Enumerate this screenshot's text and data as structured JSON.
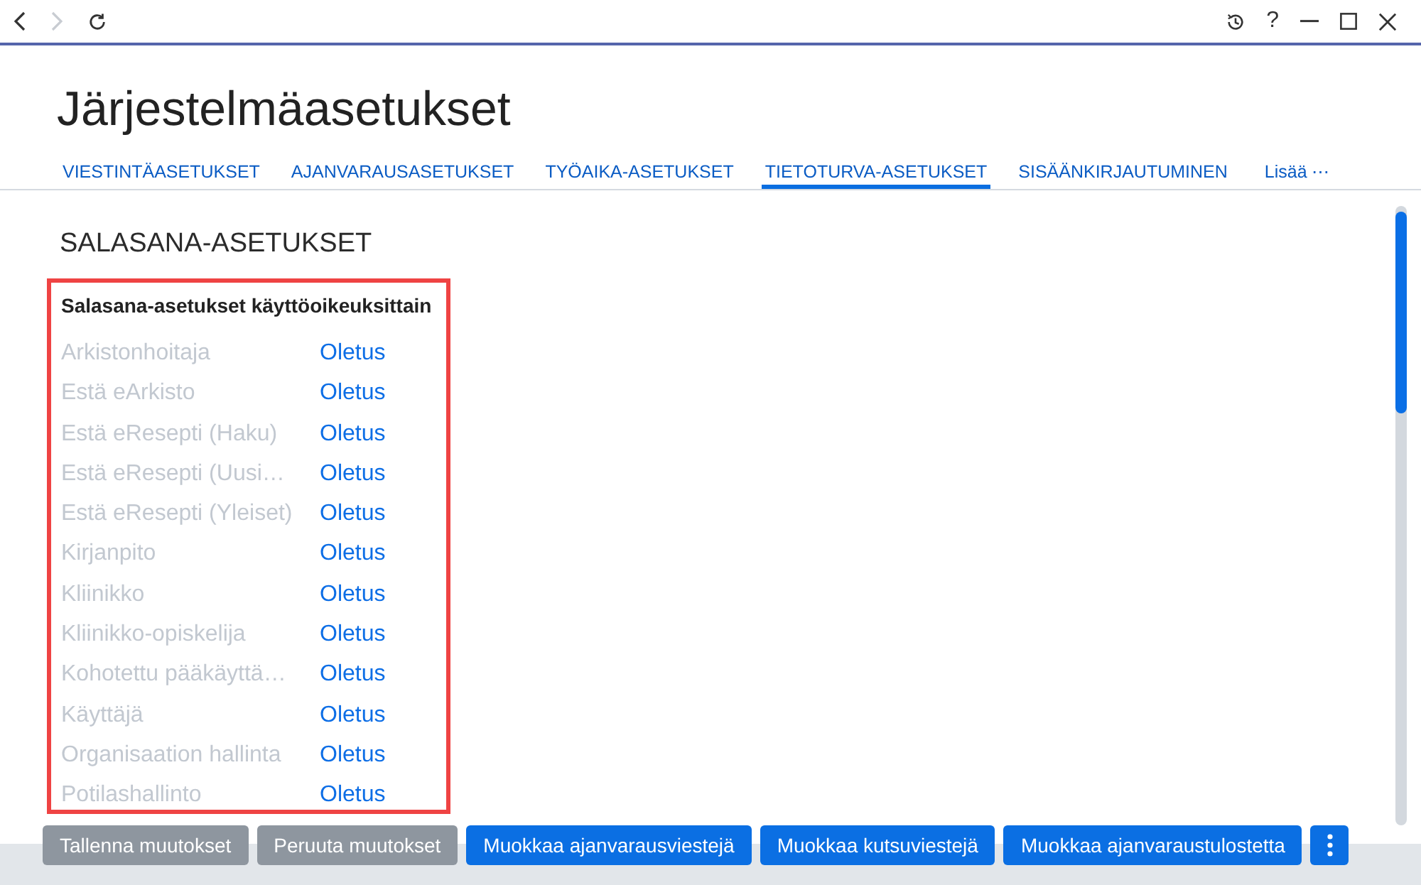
{
  "toolbar": {
    "back": {
      "disabled": false
    },
    "forward": {
      "disabled": true
    },
    "help": "?"
  },
  "page": {
    "title": "Järjestelmäasetukset"
  },
  "tabs": [
    {
      "label": "VIESTINTÄASETUKSET",
      "selected": false
    },
    {
      "label": "AJANVARAUSASETUKSET",
      "selected": false
    },
    {
      "label": "TYÖAIKA-ASETUKSET",
      "selected": false
    },
    {
      "label": "TIETOTURVA-ASETUKSET",
      "selected": true
    },
    {
      "label": "SISÄÄNKIRJAUTUMINEN",
      "selected": false
    }
  ],
  "more_tabs": "Lisää ⋯",
  "section": {
    "title": "SALASANA-ASETUKSET",
    "group": {
      "title": "Salasana-asetukset käyttöoikeuksittain",
      "rows": [
        {
          "role": "Arkistonhoitaja",
          "value": "Oletus"
        },
        {
          "role": "Estä eArkisto",
          "value": "Oletus"
        },
        {
          "role": "Estä eResepti (Haku)",
          "value": "Oletus"
        },
        {
          "role": "Estä eResepti (Uusi…",
          "value": "Oletus"
        },
        {
          "role": "Estä eResepti (Yleiset)",
          "value": "Oletus"
        },
        {
          "role": "Kirjanpito",
          "value": "Oletus"
        },
        {
          "role": "Kliinikko",
          "value": "Oletus"
        },
        {
          "role": "Kliinikko-opiskelija",
          "value": "Oletus"
        },
        {
          "role": "Kohotettu pääkäyttä…",
          "value": "Oletus"
        },
        {
          "role": "Käyttäjä",
          "value": "Oletus"
        },
        {
          "role": "Organisaation hallinta",
          "value": "Oletus"
        },
        {
          "role": "Potilashallinto",
          "value": "Oletus"
        }
      ]
    }
  },
  "buttons": [
    {
      "label": "Tallenna muutokset",
      "disabled": true
    },
    {
      "label": "Peruuta muutokset",
      "disabled": true
    },
    {
      "label": "Muokkaa ajanvarausviestejä",
      "disabled": false
    },
    {
      "label": "Muokkaa kutsuviestejä",
      "disabled": false
    },
    {
      "label": "Muokkaa ajanvaraustulostetta",
      "disabled": false
    }
  ]
}
